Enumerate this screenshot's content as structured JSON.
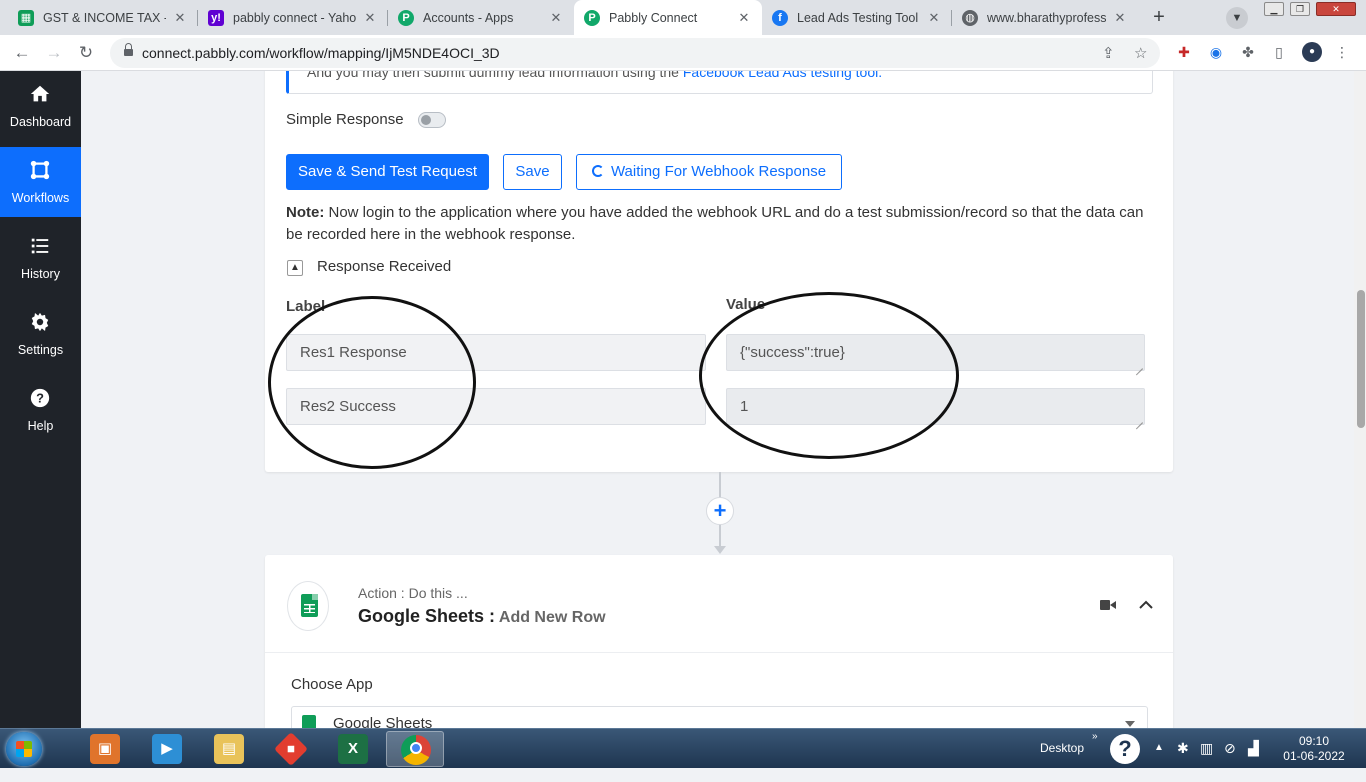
{
  "browser": {
    "tabs": [
      {
        "title": "GST & INCOME TAX - J",
        "icon": "sheets-icon",
        "color": "#0f9d58"
      },
      {
        "title": "pabbly connect - Yahoo",
        "icon": "yahoo-icon",
        "color": "#6001d2"
      },
      {
        "title": "Accounts - Apps",
        "icon": "pabbly-icon",
        "color": "#11a86a"
      },
      {
        "title": "Pabbly Connect",
        "icon": "pabbly-icon",
        "color": "#11a86a"
      },
      {
        "title": "Lead Ads Testing Tool -",
        "icon": "facebook-icon",
        "color": "#1877f2"
      },
      {
        "title": "www.bharathyprofessio",
        "icon": "globe-icon",
        "color": "#5f6368"
      }
    ],
    "url": "connect.pabbly.com/workflow/mapping/IjM5NDE4OCI_3D"
  },
  "sidebar": {
    "items": [
      {
        "label": "Dashboard",
        "icon": "home-icon"
      },
      {
        "label": "Workflows",
        "icon": "workflow-icon"
      },
      {
        "label": "History",
        "icon": "list-icon"
      },
      {
        "label": "Settings",
        "icon": "gear-icon"
      },
      {
        "label": "Help",
        "icon": "help-icon"
      }
    ]
  },
  "trigger": {
    "note_top": "And you may then submit dummy lead information using the ",
    "note_top_link": "Facebook Lead Ads testing tool.",
    "simple_response_label": "Simple Response",
    "simple_response_on": false,
    "buttons": {
      "save_send": "Save & Send Test Request",
      "save": "Save",
      "waiting": "Waiting For Webhook Response"
    },
    "note_bold": "Note:",
    "note_text": " Now login to the application where you have added the webhook URL and do a test submission/record so that the data can be recorded here in the webhook response.",
    "response_received": "Response Received",
    "label_header": "Label",
    "value_header": "Value",
    "rows": [
      {
        "label": "Res1 Response",
        "value": "{\"success\":true}"
      },
      {
        "label": "Res2 Success",
        "value": "1"
      }
    ]
  },
  "action": {
    "subtitle": "Action : Do this ...",
    "app_name": "Google Sheets :",
    "event": " Add New Row",
    "choose_app_label": "Choose App",
    "choose_app_value": "Google Sheets"
  },
  "taskbar": {
    "desktop_label": "Desktop",
    "time": "09:10",
    "date": "01-06-2022"
  },
  "colors": {
    "primary": "#0d6efd",
    "sidebar_bg": "#1f2329",
    "sheets_green": "#0f9d58"
  }
}
